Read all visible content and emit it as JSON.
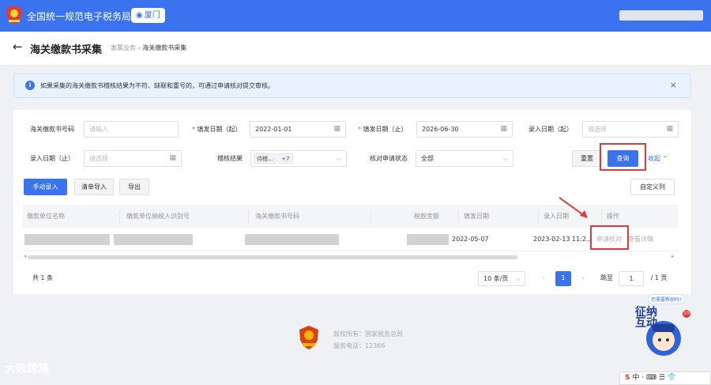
{
  "app": {
    "title": "全国统一规范电子税务局",
    "city": "厦门"
  },
  "page": {
    "title": "海关缴款书采集",
    "breadcrumb": [
      "发票业务",
      "海关缴款书采集"
    ]
  },
  "alert": {
    "text": "如果采集的海关缴款书稽核结果为不符、缺联和重号的，可通过申请核对提交审核。",
    "close": "×"
  },
  "form": {
    "f1_label": "海关缴款书号码",
    "f1_ph": "请输入",
    "f2_label": "填发日期（起）",
    "f2_value": "2022-01-01",
    "f3_label": "填发日期（止）",
    "f3_value": "2026-06-30",
    "f4_label": "录入日期（起）",
    "f4_ph": "请选择",
    "f5_label": "录入日期（止）",
    "f5_ph": "请选择",
    "f6_label": "稽核结果",
    "f6_tag": "待稽...",
    "f6_more": "+7",
    "f7_label": "核对申请状态",
    "f7_value": "全部",
    "reset": "重置",
    "query": "查询",
    "collapse": "收起"
  },
  "toolbar": {
    "manual": "手动录入",
    "import": "清单导入",
    "export": "导出",
    "custom": "自定义列"
  },
  "table": {
    "headers": [
      "缴款单位名称",
      "缴款单位纳税人识别号",
      "海关缴款书号码",
      "税款金额",
      "填发日期",
      "录入日期",
      "操作"
    ],
    "row": {
      "fill_date": "2022-05-07",
      "entry_date": "2023-02-13 11:2...",
      "op1": "申请核对",
      "op2": "查看详情"
    }
  },
  "pagination": {
    "total": "共 1 条",
    "size": "10 条/页",
    "page": "1",
    "goto": "跳至",
    "goto_value": "1",
    "pages": "/ 1 页"
  },
  "footer": {
    "copyright": "版权所有：国家税务总局",
    "phone": "服务电话：12366"
  },
  "watermark": "大数跨境",
  "bot": {
    "text": "征纳互动",
    "bubble": "您需要帮助吗?",
    "badge": "10"
  },
  "ime": "中 · ⌨ ☰ 👕"
}
